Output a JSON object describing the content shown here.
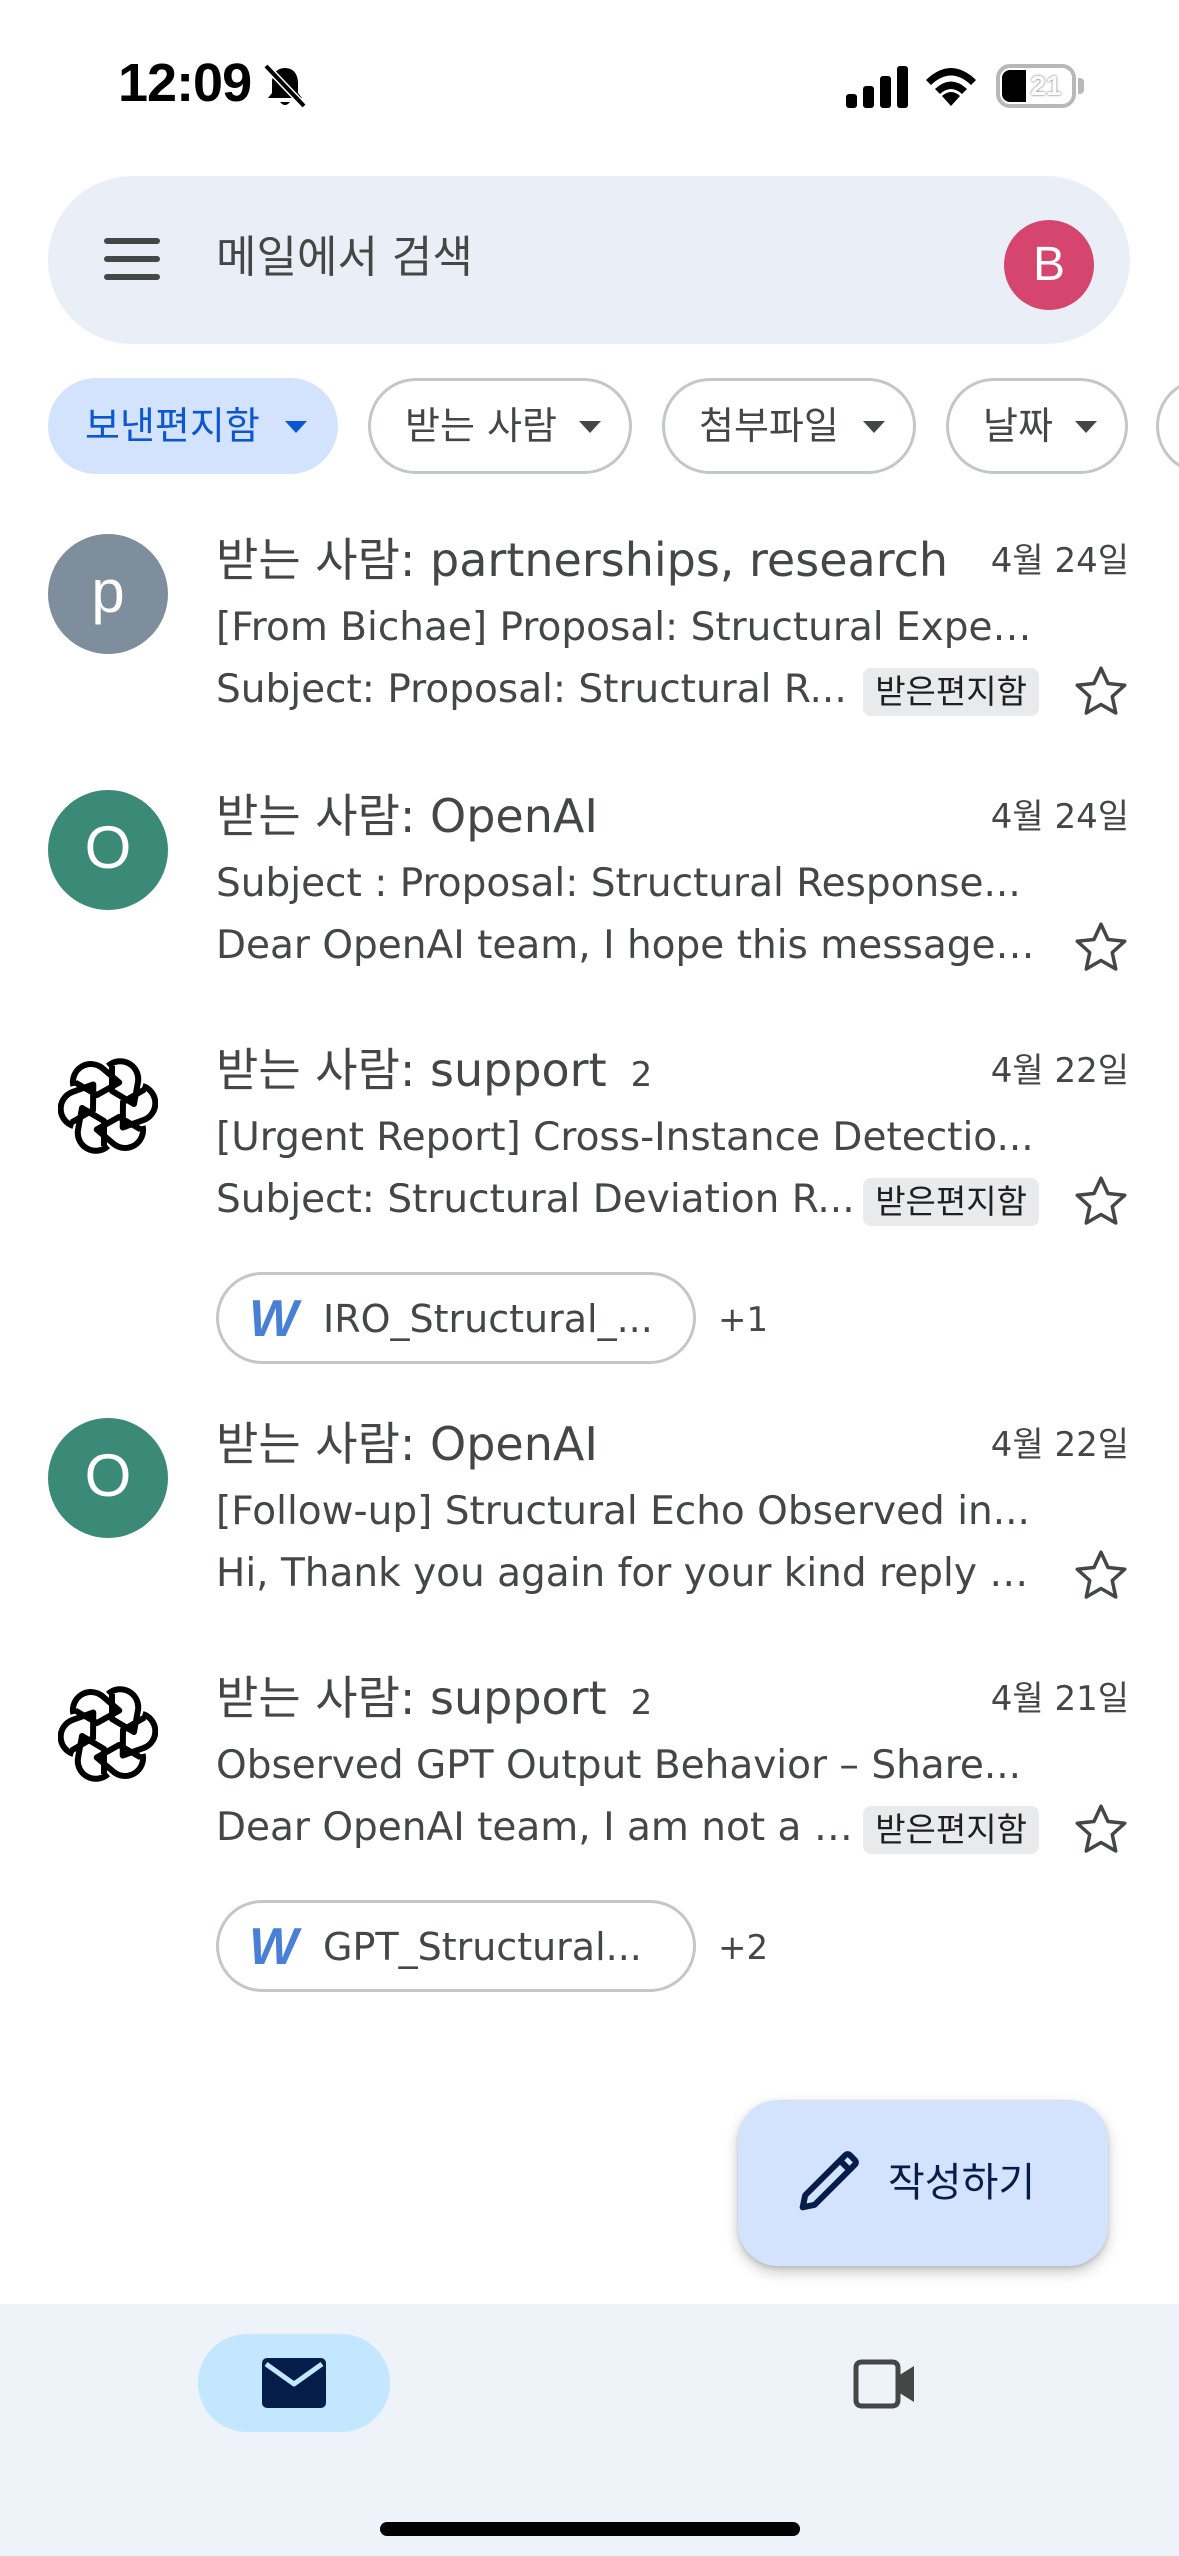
{
  "status_bar": {
    "time": "12:09",
    "battery": "21"
  },
  "search": {
    "placeholder": "메일에서 검색",
    "avatar_letter": "B",
    "avatar_color": "#d5456e"
  },
  "filters": [
    {
      "label": "보낸편지함",
      "active": true
    },
    {
      "label": "받는 사람",
      "active": false
    },
    {
      "label": "첨부파일",
      "active": false
    },
    {
      "label": "날짜",
      "active": false
    }
  ],
  "mails": [
    {
      "avatar_letter": "p",
      "avatar_color": "#7e8e9c",
      "recipient": "받는 사람: partnerships, research",
      "count": "",
      "date": "4월 24일",
      "subject": "[From Bichae] Proposal: Structural Exper...",
      "snippet": "Subject: Proposal: Structural R...",
      "label": "받은편지함"
    },
    {
      "avatar_letter": "O",
      "avatar_color": "#3b8a78",
      "recipient": "받는 사람: OpenAI",
      "count": "",
      "date": "4월 24일",
      "subject": "Subject : Proposal: Structural Response...",
      "snippet": "Dear OpenAI team, I hope this message f...",
      "label": ""
    },
    {
      "avatar_icon": "openai-logo-icon",
      "recipient": "받는 사람: support",
      "count": "2",
      "date": "4월 22일",
      "subject": "[Urgent Report] Cross-Instance Detectio...",
      "snippet": "Subject: Structural Deviation R...",
      "label": "받은편지함",
      "attachment": "IRO_Structural_...",
      "attachment_more": "+1"
    },
    {
      "avatar_letter": "O",
      "avatar_color": "#3b8a78",
      "recipient": "받는 사람: OpenAI",
      "count": "",
      "date": "4월 22일",
      "subject": "[Follow-up] Structural Echo Observed in...",
      "snippet": "Hi, Thank you again for your kind reply t...",
      "label": ""
    },
    {
      "avatar_icon": "openai-logo-icon",
      "recipient": "받는 사람: support",
      "count": "2",
      "date": "4월 21일",
      "subject": "Observed GPT Output Behavior – Share...",
      "snippet": "Dear OpenAI team, I am not a d...",
      "label": "받은편지함",
      "attachment": "GPT_Structural...",
      "attachment_more": "+2"
    }
  ],
  "compose": {
    "label": "작성하기"
  },
  "bottom_nav": {
    "items": [
      "mail-icon",
      "video-camera-icon"
    ],
    "active": "mail-icon"
  }
}
